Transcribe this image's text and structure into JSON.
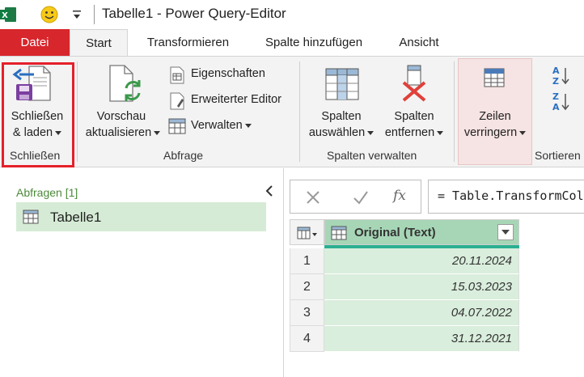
{
  "titlebar": {
    "title": "Tabelle1 - Power Query-Editor"
  },
  "tabs": [
    {
      "label": "Datei"
    },
    {
      "label": "Start"
    },
    {
      "label": "Transformieren"
    },
    {
      "label": "Spalte hinzufügen"
    },
    {
      "label": "Ansicht"
    }
  ],
  "ribbon": {
    "close_group": {
      "label": "Schließen",
      "button_line1": "Schließen",
      "button_line2": "& laden"
    },
    "query_group": {
      "label": "Abfrage",
      "preview_line1": "Vorschau",
      "preview_line2": "aktualisieren",
      "properties": "Eigenschaften",
      "advanced_editor": "Erweiterter Editor",
      "manage": "Verwalten"
    },
    "columns_group": {
      "label": "Spalten verwalten",
      "select_line1": "Spalten",
      "select_line2": "auswählen",
      "remove_line1": "Spalten",
      "remove_line2": "entfernen"
    },
    "rows_group": {
      "reduce_line1": "Zeilen",
      "reduce_line2": "verringern"
    },
    "sort_group": {
      "label": "Sortieren"
    }
  },
  "queries_pane": {
    "header": "Abfragen [1]",
    "items": [
      {
        "label": "Tabelle1"
      }
    ]
  },
  "formula_bar": {
    "fx": "fx",
    "formula": "= Table.TransformColumnTypes("
  },
  "grid": {
    "column_header": "Original (Text)",
    "rows": [
      {
        "num": "1",
        "value": "20.11.2024"
      },
      {
        "num": "2",
        "value": "15.03.2023"
      },
      {
        "num": "3",
        "value": "04.07.2022"
      },
      {
        "num": "4",
        "value": "31.12.2021"
      }
    ]
  },
  "colors": {
    "file_tab": "#d7262c",
    "selection": "#d5ebd5",
    "column_header": "#a7d6b6",
    "highlight": "#e5202a"
  }
}
